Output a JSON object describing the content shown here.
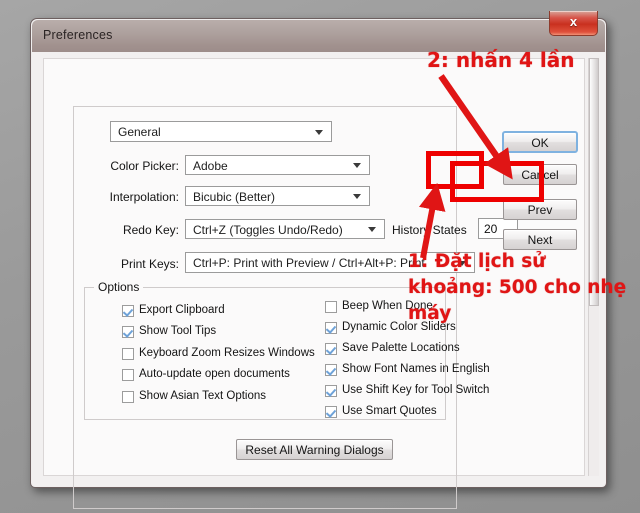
{
  "window": {
    "title": "Preferences",
    "close_glyph": "x",
    "close_icon_name": "close-icon"
  },
  "preset_combo": {
    "value": "General"
  },
  "fields": [
    {
      "label": "Color Picker:",
      "value": "Adobe"
    },
    {
      "label": "Interpolation:",
      "value": "Bicubic (Better)"
    },
    {
      "label": "Redo Key:",
      "value": "Ctrl+Z (Toggles Undo/Redo)"
    },
    {
      "label": "Print Keys:",
      "value": "Ctrl+P: Print with Preview / Ctrl+Alt+P: Print"
    }
  ],
  "history_states": {
    "label": "History States",
    "value": "20"
  },
  "options": {
    "legend": "Options",
    "left_column": [
      {
        "label": "Export Clipboard",
        "checked": true
      },
      {
        "label": "Show Tool Tips",
        "checked": true
      },
      {
        "label": "Keyboard Zoom Resizes Windows",
        "checked": false
      },
      {
        "label": "Auto-update open documents",
        "checked": false
      },
      {
        "label": "Show Asian Text Options",
        "checked": false
      }
    ],
    "right_column": [
      {
        "label": "Beep When Done",
        "checked": false
      },
      {
        "label": "Dynamic Color Sliders",
        "checked": true
      },
      {
        "label": "Save Palette Locations",
        "checked": true
      },
      {
        "label": "Show Font Names in English",
        "checked": true
      },
      {
        "label": "Use Shift Key for Tool Switch",
        "checked": true
      },
      {
        "label": "Use Smart Quotes",
        "checked": true
      }
    ]
  },
  "reset_button": {
    "label": "Reset All Warning Dialogs"
  },
  "side_buttons": {
    "ok": "OK",
    "cancel": "Cancel",
    "prev": "Prev",
    "next": "Next"
  },
  "annotations": {
    "step2": "2: nhấn 4 lần",
    "step1": "1: Đặt lịch sử khoảng: 500 cho nhẹ máy",
    "color": "#e01515",
    "highlight_box_color": "#ee0000"
  }
}
